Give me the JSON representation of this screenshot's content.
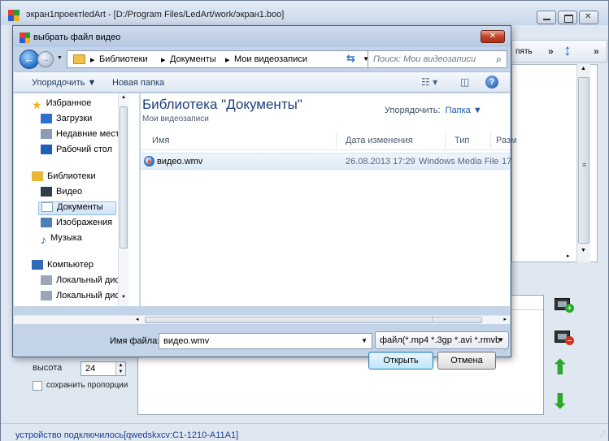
{
  "main_window": {
    "title": "экран1проектledArt - [D:/Program Files/LedArt/work/экран1.boo]",
    "toolbar_text": "пять",
    "toolbar_overflow": "»",
    "status": "устройство подключилось[qwedskxcv:C1-1210-A11A1]",
    "side": {
      "height_label": "высота",
      "height_value": "24",
      "keep_ratio_label": "сохранить пропорции"
    }
  },
  "dialog": {
    "title": "выбрать файл видео",
    "close_glyph": "✕",
    "address": {
      "sep": "▸",
      "segments": [
        "Библиотеки",
        "Документы",
        "Мои видеозаписи"
      ]
    },
    "search_placeholder": "Поиск: Мои видеозаписи",
    "commands": {
      "organize": "Упорядочить ▼",
      "new_folder": "Новая папка"
    },
    "nav": [
      {
        "label": "Избранное",
        "icon": "star-icon"
      },
      {
        "label": "Загрузки",
        "icon": "downloads-icon"
      },
      {
        "label": "Недавние места",
        "icon": "recent-icon"
      },
      {
        "label": "Рабочий стол",
        "icon": "desktop-icon"
      },
      {
        "label": "Библиотеки",
        "icon": "libraries-icon"
      },
      {
        "label": "Видео",
        "icon": "video-icon"
      },
      {
        "label": "Документы",
        "icon": "documents-icon"
      },
      {
        "label": "Изображения",
        "icon": "images-icon"
      },
      {
        "label": "Музыка",
        "icon": "music-icon"
      },
      {
        "label": "Компьютер",
        "icon": "computer-icon"
      },
      {
        "label": "Локальный диск",
        "icon": "disk-icon"
      },
      {
        "label": "Локальный диск",
        "icon": "disk-icon"
      }
    ],
    "library_title": "Библиотека \"Документы\"",
    "library_sub": "Мои видеозаписи",
    "arrange_label": "Упорядочить:",
    "arrange_value": "Папка ▼",
    "columns": [
      "Имя",
      "Дата изменения",
      "Тип",
      "Разм"
    ],
    "files": [
      {
        "name": "видео.wmv",
        "date": "26.08.2013 17:29",
        "type": "Windows Media File",
        "size": "17"
      }
    ],
    "filename_label": "Имя файла:",
    "filename_value": "видео.wmv",
    "filter": "файл(*.mp4 *.3gp *.avi *.rmvb",
    "open_label": "Открыть",
    "cancel_label": "Отмена"
  },
  "colors": {
    "accent": "#1e3e79",
    "status_text": "#1a3e8f",
    "arrow_green": "#2aa82a",
    "close_red": "#c2442a"
  }
}
